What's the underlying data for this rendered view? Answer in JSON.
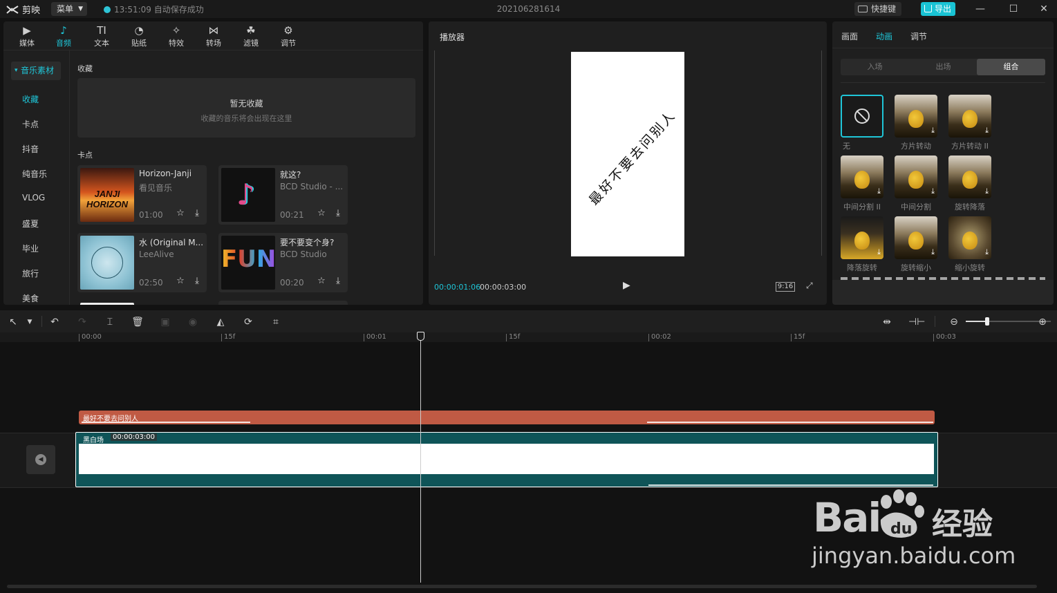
{
  "app": {
    "name": "剪映",
    "menu_label": "菜单",
    "save_status": "13:51:09 自动保存成功",
    "doc_title": "202106281614",
    "shortcut_label": "快捷键",
    "export_label": "导出"
  },
  "tabs": [
    {
      "label": "媒体",
      "icon": "media-icon",
      "glyph": "▶"
    },
    {
      "label": "音频",
      "icon": "audio-icon",
      "glyph": "♪"
    },
    {
      "label": "文本",
      "icon": "text-icon",
      "glyph": "TI"
    },
    {
      "label": "贴纸",
      "icon": "sticker-icon",
      "glyph": "◔"
    },
    {
      "label": "特效",
      "icon": "effects-icon",
      "glyph": "✧"
    },
    {
      "label": "转场",
      "icon": "transition-icon",
      "glyph": "⋈"
    },
    {
      "label": "滤镜",
      "icon": "filter-icon",
      "glyph": "☘"
    },
    {
      "label": "调节",
      "icon": "adjust-icon",
      "glyph": "⚙"
    }
  ],
  "active_tab": "音频",
  "categories": {
    "header": "音乐素材",
    "items": [
      "收藏",
      "卡点",
      "抖音",
      "纯音乐",
      "VLOG",
      "盛夏",
      "毕业",
      "旅行",
      "美食"
    ],
    "active": "收藏"
  },
  "favorites": {
    "label": "收藏",
    "empty_title": "暂无收藏",
    "empty_sub": "收藏的音乐将会出现在这里"
  },
  "beat_section": {
    "label": "卡点"
  },
  "music": [
    {
      "title": "Horizon-Janji",
      "artist": "看见音乐",
      "duration": "01:00",
      "cover_text": "JANJI HORIZON"
    },
    {
      "title": "就这?",
      "artist": "BCD Studio - ...",
      "duration": "00:21",
      "cover_text": ""
    },
    {
      "title": "水 (Original M...",
      "artist": "LeeAlive",
      "duration": "02:50",
      "cover_text": ""
    },
    {
      "title": "要不要变个身?",
      "artist": "BCD Studio",
      "duration": "00:20",
      "cover_text": "FUN"
    }
  ],
  "player": {
    "title": "播放器",
    "video_text": "最好不要去问别人",
    "current_time": "00:00:01:06",
    "total_time": "00:00:03:00",
    "ratio": "9:16"
  },
  "anim_panel": {
    "tabs": [
      "画面",
      "动画",
      "调节"
    ],
    "active_tab": "动画",
    "sub_tabs": [
      "入场",
      "出场",
      "组合"
    ],
    "active_sub": "组合",
    "items": [
      "无",
      "方片转动",
      "方片转动 II",
      "中间分割 II",
      "中间分割",
      "旋转降落",
      "降落旋转",
      "旋转缩小",
      "缩小旋转"
    ]
  },
  "timeline": {
    "ticks": [
      "00:00",
      "15f",
      "00:01",
      "15f",
      "00:02",
      "15f",
      "00:03"
    ],
    "text_clip": "最好不要去问别人",
    "video_clip": {
      "name": "黑白场",
      "duration": "00:00:03:00"
    },
    "zoom_level": 0.25
  },
  "watermark": {
    "brand": "Bai",
    "brand2": "du",
    "suffix": "经验",
    "url": "jingyan.baidu.com"
  },
  "colors": {
    "accent": "#1fc6d8",
    "text_track": "#c05a44",
    "video_track": "#0f5458"
  }
}
